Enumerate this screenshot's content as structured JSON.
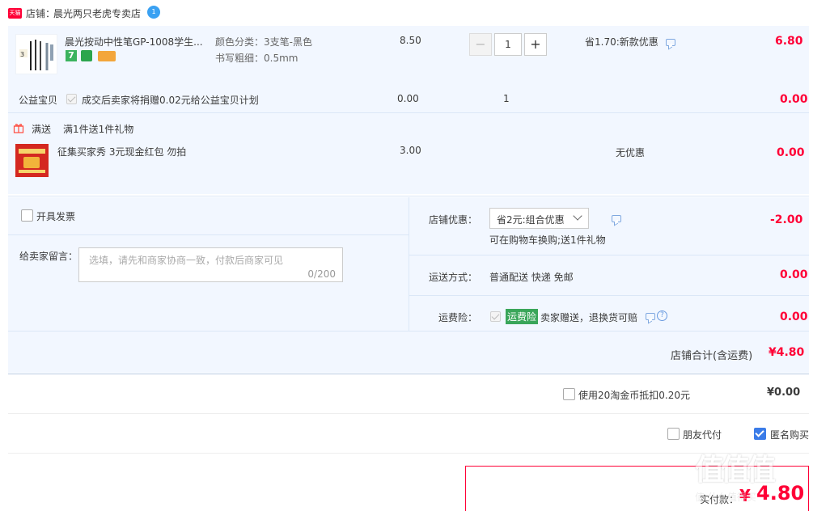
{
  "shop": {
    "badge": "天猫",
    "label": "店铺：",
    "name": "晨光两只老虎专卖店",
    "chat_badge": "1"
  },
  "item": {
    "title": "晨光按动中性笔GP-1008学生...",
    "spec_color": "颜色分类：3支笔-黑色",
    "spec_width": "书写粗细：0.5mm",
    "price": "8.50",
    "quantity": "1",
    "minus": "−",
    "plus": "+",
    "discount": "省1.70:新款优惠",
    "subtotal": "6.80",
    "badge_7": "7"
  },
  "charity": {
    "label": "公益宝贝",
    "text": "成交后卖家将捐赠0.02元给公益宝贝计划",
    "price": "0.00",
    "quantity": "1",
    "subtotal": "0.00"
  },
  "gift": {
    "tag": "满送",
    "rule": "满1件送1件礼物",
    "title": "征集买家秀 3元现金红包 勿拍",
    "price": "3.00",
    "discount": "无优惠",
    "subtotal": "0.00"
  },
  "invoice": {
    "label": "开具发票"
  },
  "message": {
    "label": "给卖家留言：",
    "placeholder": "选填，请先和商家协商一致，付款后商家可见",
    "counter": "0/200"
  },
  "coupon": {
    "label": "店铺优惠：",
    "selected": "省2元:组合优惠",
    "note": "可在购物车换购;送1件礼物",
    "amount": "-2.00"
  },
  "shipping": {
    "label": "运送方式：",
    "value": "普通配送 快递 免邮",
    "amount": "0.00"
  },
  "insurance": {
    "label": "运费险：",
    "tag": "运费险",
    "text": "卖家赠送，退换货可赔",
    "amount": "0.00"
  },
  "shop_total": {
    "label": "店铺合计(含运费)",
    "amount": "¥4.80"
  },
  "coins": {
    "text": "使用20淘金币抵扣0.20元",
    "amount": "¥0.00"
  },
  "options": {
    "friend_pay": "朋友代付",
    "anonymous": "匿名购买"
  },
  "pay": {
    "label": "实付款：",
    "amount": "4.80"
  },
  "watermark": "值 什么值得买"
}
